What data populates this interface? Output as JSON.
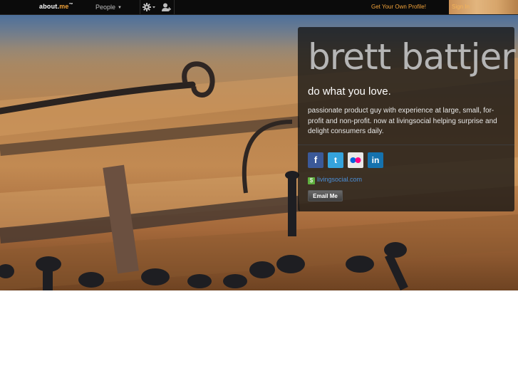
{
  "nav": {
    "logo_prefix": "about.",
    "logo_accent": "me",
    "logo_tm": "™",
    "people_label": "People",
    "get_profile_label": "Get Your Own Profile!",
    "sign_in_label": "Sign In"
  },
  "profile": {
    "name": "brett battjer",
    "headline": "do what you love.",
    "bio": "passionate product guy with experience at large, small, for-profit and non-profit. now at livingsocial helping surprise and delight consumers daily.",
    "website": "livingsocial.com",
    "email_button": "Email Me"
  },
  "socials": [
    {
      "name": "facebook",
      "glyph": "f"
    },
    {
      "name": "twitter",
      "glyph": "t"
    },
    {
      "name": "flickr",
      "glyph": "●●"
    },
    {
      "name": "linkedin",
      "glyph": "in"
    }
  ],
  "colors": {
    "accent": "#f2a33a",
    "link": "#4a8fd8"
  },
  "icons": {
    "settings": "gear-icon",
    "account": "user-icon",
    "website_badge": "dollar-badge-icon"
  }
}
